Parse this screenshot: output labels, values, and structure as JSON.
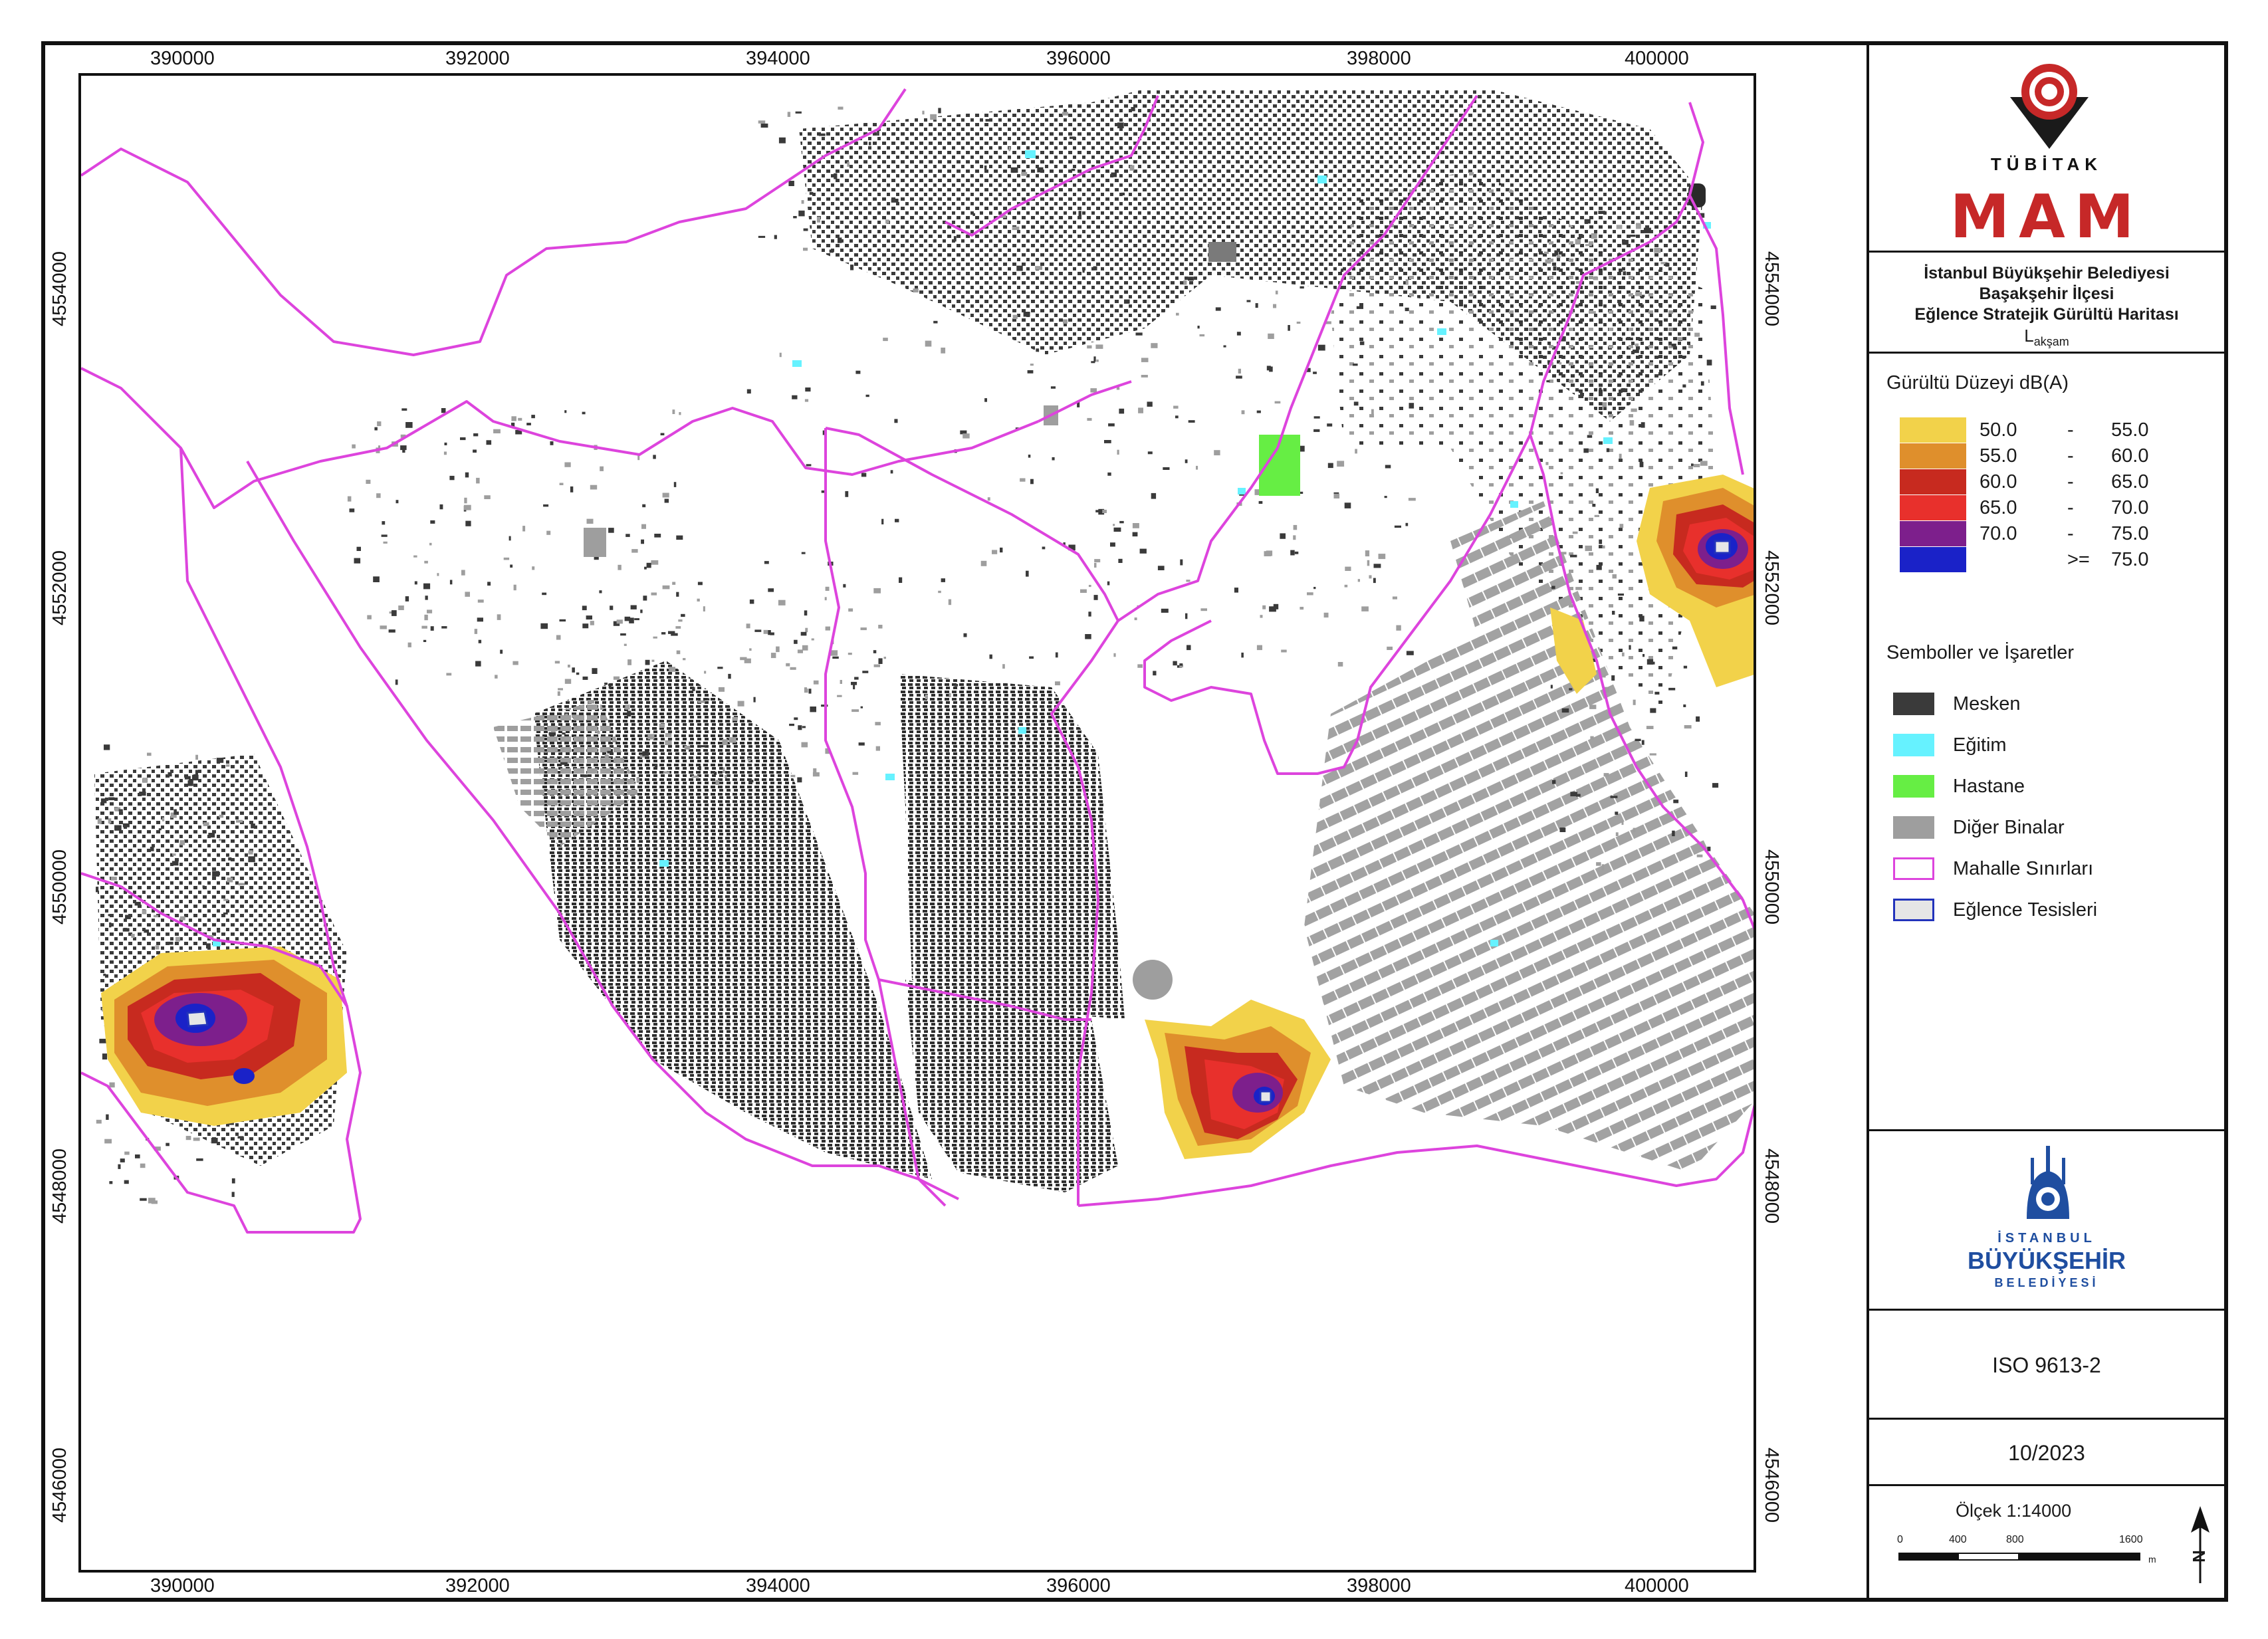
{
  "map": {
    "x_ticks_top": [
      "390000",
      "392000",
      "394000",
      "396000",
      "398000",
      "400000"
    ],
    "x_ticks_bottom": [
      "390000",
      "392000",
      "394000",
      "396000",
      "398000",
      "400000"
    ],
    "y_ticks_left": [
      "4554000",
      "4552000",
      "4550000",
      "4548000",
      "4546000"
    ],
    "y_ticks_right": [
      "4554000",
      "4552000",
      "4550000",
      "4548000",
      "4546000"
    ],
    "colors": {
      "boundary": "#dd44dd",
      "residential": "#3a3a3a",
      "education": "#66f2ff",
      "hospital": "#66ee44",
      "other": "#9e9e9e",
      "entertainment_outline": "#2233bb"
    }
  },
  "logo_top": {
    "org": "TÜBİTAK",
    "unit": "MAM"
  },
  "title": {
    "line1": "İstanbul Büyükşehir Belediyesi",
    "line2": "Başakşehir İlçesi",
    "line3": "Eğlence Stratejik Gürültü Haritası",
    "symbol": "L",
    "symbol_sub": "akşam"
  },
  "noise_legend": {
    "heading": "Gürültü Düzeyi dB(A)",
    "classes": [
      {
        "lo": "50.0",
        "sep": "-",
        "hi": "55.0",
        "color": "#f2d24a"
      },
      {
        "lo": "55.0",
        "sep": "-",
        "hi": "60.0",
        "color": "#df8f2c"
      },
      {
        "lo": "60.0",
        "sep": "-",
        "hi": "65.0",
        "color": "#c72a1f"
      },
      {
        "lo": "65.0",
        "sep": "-",
        "hi": "70.0",
        "color": "#e8302c"
      },
      {
        "lo": "70.0",
        "sep": "-",
        "hi": "75.0",
        "color": "#7d1f8c"
      },
      {
        "lo": "",
        "sep": ">=",
        "hi": "75.0",
        "color": "#1a22c8"
      }
    ]
  },
  "symbols_legend": {
    "heading": "Semboller ve İşaretler",
    "items": [
      {
        "label": "Mesken",
        "color": "#3a3a3a",
        "border": "#3a3a3a"
      },
      {
        "label": "Eğitim",
        "color": "#66f2ff",
        "border": "#66f2ff"
      },
      {
        "label": "Hastane",
        "color": "#66ee44",
        "border": "#66ee44"
      },
      {
        "label": "Diğer Binalar",
        "color": "#9e9e9e",
        "border": "#9e9e9e"
      },
      {
        "label": "Mahalle Sınırları",
        "color": "#ffffff",
        "border": "#dd44dd"
      },
      {
        "label": "Eğlence Tesisleri",
        "color": "#e6e6e6",
        "border": "#2233bb"
      }
    ]
  },
  "logo_bottom": {
    "line1": "İSTANBUL",
    "line2": "BÜYÜKŞEHİR",
    "line3": "BELEDİYESİ"
  },
  "standard": "ISO 9613-2",
  "date": "10/2023",
  "scale": {
    "label": "Ölçek 1:14000",
    "ticks": [
      "0",
      "400",
      "800",
      "1600"
    ],
    "unit": "m",
    "north": "N"
  }
}
